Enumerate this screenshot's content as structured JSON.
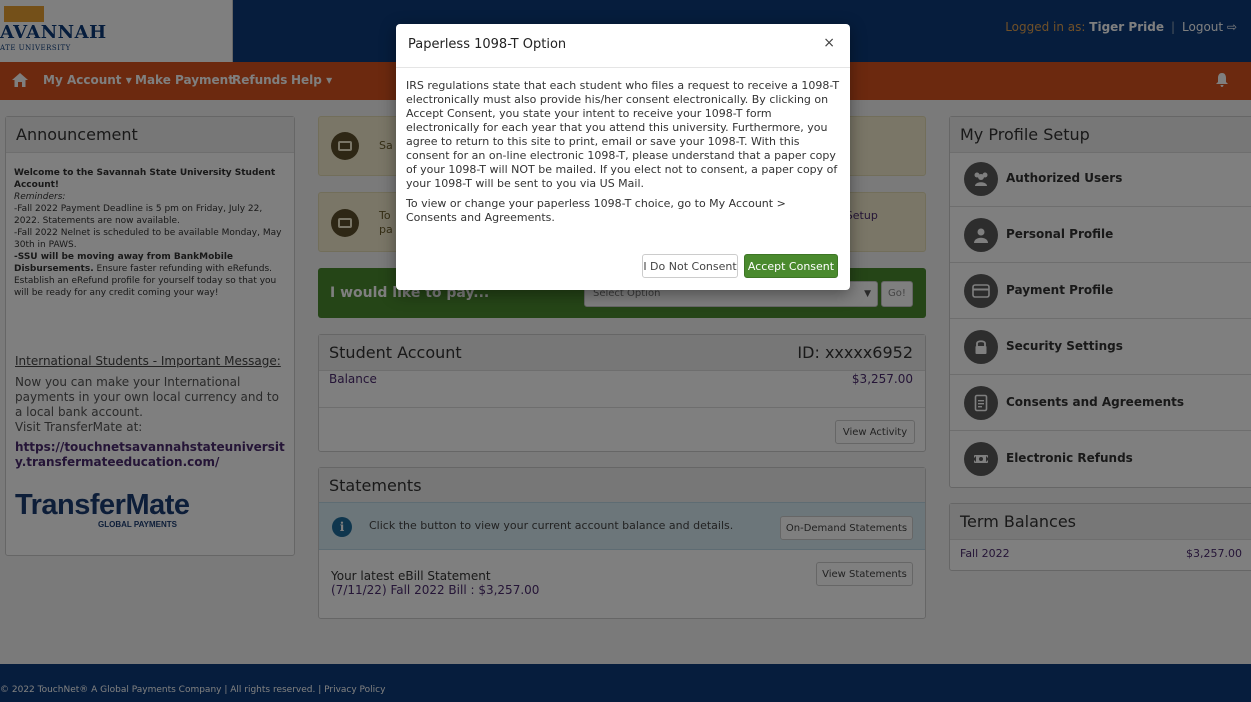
{
  "header": {
    "logo_title": "AVANNAH",
    "logo_subtitle": "ATE UNIVERSITY",
    "logged_in_label": "Logged in as: ",
    "user_name": "Tiger Pride",
    "logout_label": "Logout",
    "bg_color": "#0d3b7a"
  },
  "nav": {
    "items": [
      {
        "label": "My Account ▾"
      },
      {
        "label": "Make Payment"
      },
      {
        "label": "Refunds"
      },
      {
        "label": "Help ▾"
      }
    ],
    "bg_color": "#d8531e"
  },
  "announcement": {
    "title": "Announcement",
    "welcome": "Welcome to the Savannah State University Student Account!",
    "reminders_label": "Reminders:",
    "reminder_1": "-Fall 2022 Payment Deadline is 5 pm on Friday, July 22, 2022. Statements are now available.",
    "reminder_2": "-Fall 2022 Nelnet is scheduled to be available Monday, May 30th in PAWS.",
    "reminder_3_bold": "-SSU will be moving away from BankMobile Disbursements.",
    "reminder_3_rest": " Ensure faster refunding with eRefunds. Establish an eRefund profile for yourself today so that you will be ready for any credit coming your way!",
    "intl_title": "International Students - Important Message:",
    "intl_text": "Now you can make your International payments in your own local currency and to a local bank account.",
    "intl_visit": "Visit TransferMate at:",
    "intl_url": "https://touchnetsavannahstateuniversity.transfermateeducation.com/",
    "transfermate_logo": "TransferMate",
    "transfermate_sub": "GLOBAL PAYMENTS"
  },
  "notices": {
    "notice_1": "Sa",
    "notice_2_line1": "To",
    "notice_2_line2": "pa",
    "notice_2_right": "nt Setup"
  },
  "pay": {
    "label": "I would like to pay...",
    "select_placeholder": "Select Option",
    "go_label": "Go!"
  },
  "student_account": {
    "title": "Student Account",
    "id": "ID: xxxxx6952",
    "balance_label": "Balance",
    "balance_value": "$3,257.00",
    "view_activity": "View Activity"
  },
  "statements": {
    "title": "Statements",
    "info": "Click the button to view your current account balance and details.",
    "on_demand_button": "On-Demand Statements",
    "latest_title": "Your latest eBill Statement",
    "latest_line": "(7/11/22) Fall 2022 Bill :   $3,257.00",
    "view_statements": "View Statements"
  },
  "profile": {
    "title": "My Profile Setup",
    "items": [
      {
        "label": "Authorized Users",
        "icon": "users-icon"
      },
      {
        "label": "Personal Profile",
        "icon": "user-icon"
      },
      {
        "label": "Payment Profile",
        "icon": "credit-card-icon"
      },
      {
        "label": "Security Settings",
        "icon": "lock-icon"
      },
      {
        "label": "Consents and Agreements",
        "icon": "document-icon"
      },
      {
        "label": "Electronic Refunds",
        "icon": "refund-icon"
      }
    ]
  },
  "term_balances": {
    "title": "Term Balances",
    "rows": [
      {
        "term": "Fall 2022",
        "amount": "$3,257.00"
      }
    ]
  },
  "footer": {
    "text": "© 2022 TouchNet® A Global Payments Company | All rights reserved. | Privacy Policy"
  },
  "modal": {
    "title": "Paperless 1098-T Option",
    "close": "×",
    "paragraph_1": "IRS regulations state that each student who files a request to receive a 1098-T electronically must also provide his/her consent electronically. By clicking on Accept Consent, you state your intent to receive your 1098-T form electronically for each year that you attend this university. Furthermore, you agree to return to this site to print, email or save your 1098-T. With this consent for an on-line electronic 1098-T, please understand that a paper copy of your 1098-T will NOT be mailed. If you elect not to consent, a paper copy of your 1098-T will be sent to you via US Mail.",
    "paragraph_2": "To view or change your paperless 1098-T choice, go to My Account > Consents and Agreements.",
    "decline_button": "I Do Not Consent",
    "accept_button": "Accept Consent",
    "accept_color": "#4a8a2e"
  }
}
